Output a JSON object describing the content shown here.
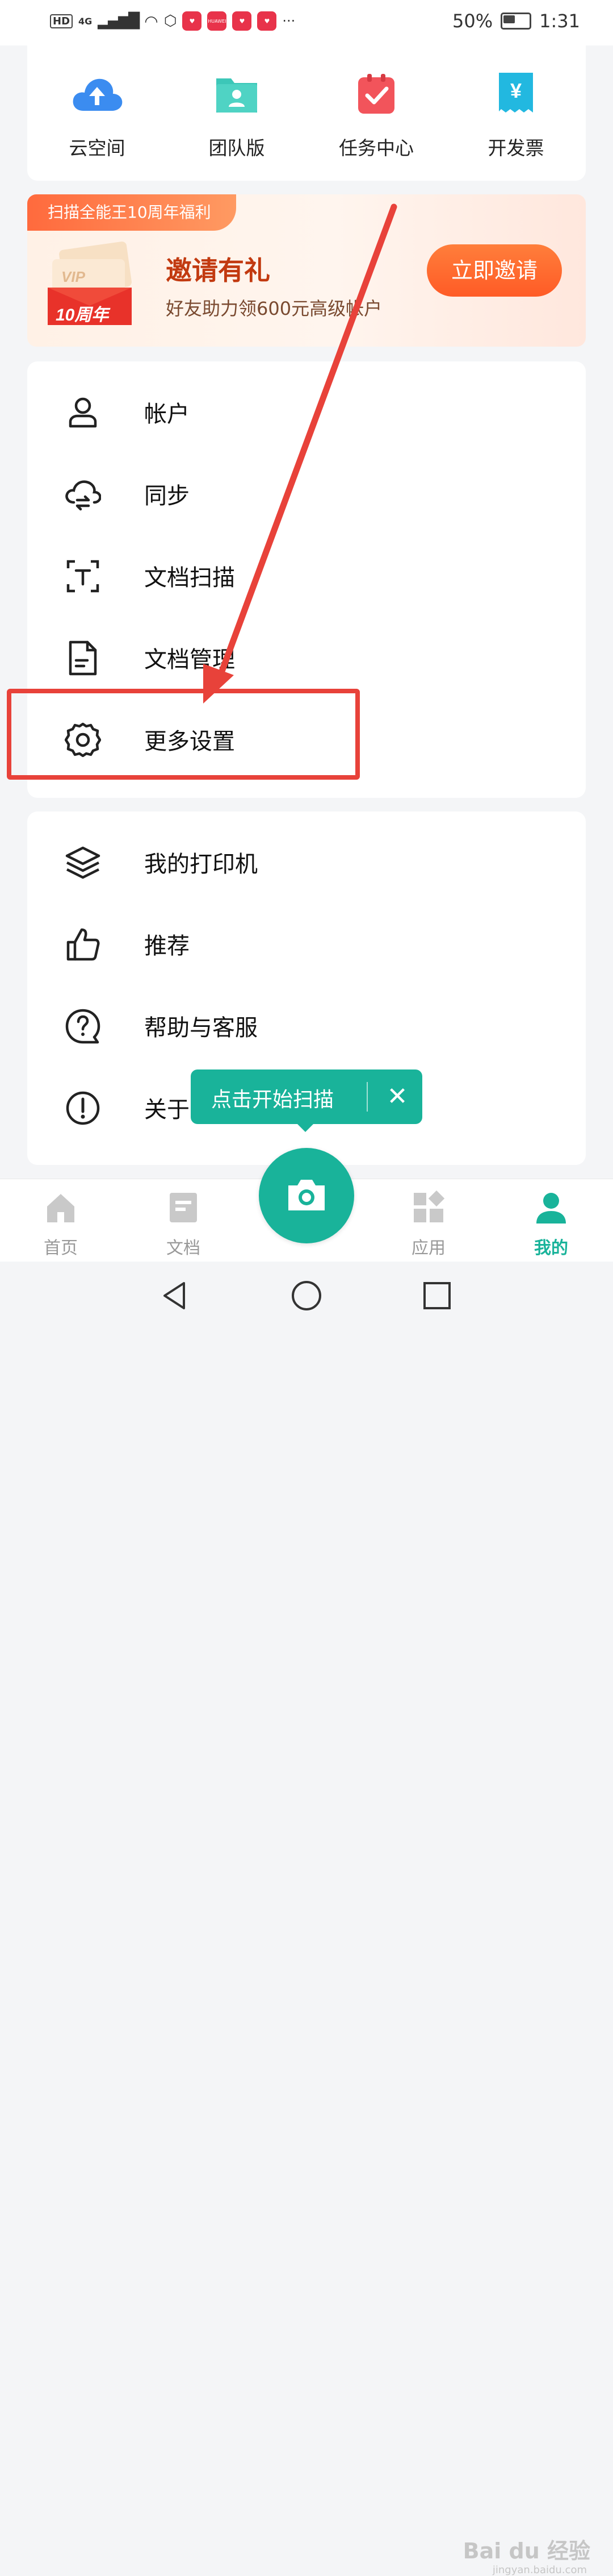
{
  "status_bar": {
    "network": "4G",
    "hd_label": "HD",
    "battery_percent": "50%",
    "battery_level": 0.5,
    "time": "1:31",
    "more": "···",
    "app_badge_text": "HUAWEI"
  },
  "quick_actions": [
    {
      "label": "云空间",
      "icon": "cloud-upload-icon"
    },
    {
      "label": "团队版",
      "icon": "team-folder-icon"
    },
    {
      "label": "任务中心",
      "icon": "task-check-icon"
    },
    {
      "label": "开发票",
      "icon": "invoice-yen-icon"
    }
  ],
  "banner": {
    "tag": "扫描全能王10周年福利",
    "title": "邀请有礼",
    "subtitle": "好友助力领600元高级帐户",
    "button": "立即邀请",
    "ticket_text": "10周年",
    "ticket_vip": "VIP"
  },
  "menu_group_1": [
    {
      "label": "帐户",
      "icon": "person-icon"
    },
    {
      "label": "同步",
      "icon": "cloud-sync-icon"
    },
    {
      "label": "文档扫描",
      "icon": "text-scan-icon"
    },
    {
      "label": "文档管理",
      "icon": "document-icon"
    },
    {
      "label": "更多设置",
      "icon": "gear-icon"
    }
  ],
  "menu_group_2": [
    {
      "label": "我的打印机",
      "icon": "layers-icon"
    },
    {
      "label": "推荐",
      "icon": "thumbs-up-icon"
    },
    {
      "label": "帮助与客服",
      "icon": "help-chat-icon"
    },
    {
      "label": "关于",
      "icon": "info-icon"
    }
  ],
  "tooltip": {
    "text": "点击开始扫描",
    "close": "✕"
  },
  "tab_bar": [
    {
      "label": "首页",
      "icon": "home-icon",
      "active": false
    },
    {
      "label": "文档",
      "icon": "doc-tab-icon",
      "active": false
    },
    {
      "label": "应用",
      "icon": "apps-icon",
      "active": false
    },
    {
      "label": "我的",
      "icon": "profile-icon",
      "active": true
    }
  ],
  "watermark": {
    "text": "Bai du 经验",
    "sub": "jingyan.baidu.com"
  },
  "colors": {
    "accent": "#19b39a",
    "annotation_red": "#e8423a",
    "banner_orange": "#ff5b26"
  }
}
